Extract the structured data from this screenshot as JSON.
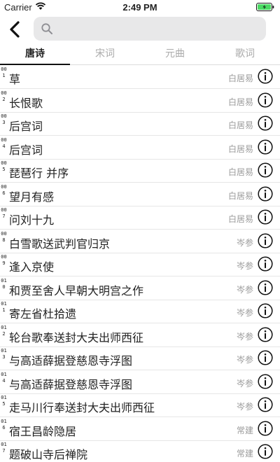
{
  "status": {
    "carrier": "Carrier",
    "time": "2:49 PM"
  },
  "search": {
    "value": "",
    "placeholder": ""
  },
  "tabs": [
    {
      "label": "唐诗",
      "active": true
    },
    {
      "label": "宋词",
      "active": false
    },
    {
      "label": "元曲",
      "active": false
    },
    {
      "label": "歌词",
      "active": false
    }
  ],
  "poems": [
    {
      "index": "001",
      "title": "草",
      "author": "白居易"
    },
    {
      "index": "002",
      "title": "长恨歌",
      "author": "白居易"
    },
    {
      "index": "003",
      "title": "后宫词",
      "author": "白居易"
    },
    {
      "index": "004",
      "title": "后宫词",
      "author": "白居易"
    },
    {
      "index": "005",
      "title": "琵琶行 并序",
      "author": "白居易"
    },
    {
      "index": "006",
      "title": "望月有感",
      "author": "白居易"
    },
    {
      "index": "007",
      "title": "问刘十九",
      "author": "白居易"
    },
    {
      "index": "008",
      "title": "白雪歌送武判官归京",
      "author": "岑参"
    },
    {
      "index": "009",
      "title": "逢入京使",
      "author": "岑参"
    },
    {
      "index": "010",
      "title": "和贾至舍人早朝大明宫之作",
      "author": "岑参"
    },
    {
      "index": "011",
      "title": "寄左省杜拾遗",
      "author": "岑参"
    },
    {
      "index": "012",
      "title": "轮台歌奉送封大夫出师西征",
      "author": "岑参"
    },
    {
      "index": "013",
      "title": "与高适薛据登慈恩寺浮图",
      "author": "岑参"
    },
    {
      "index": "014",
      "title": "与高适薛据登慈恩寺浮图",
      "author": "岑参"
    },
    {
      "index": "015",
      "title": "走马川行奉送封大夫出师西征",
      "author": "岑参"
    },
    {
      "index": "016",
      "title": "宿王昌龄隐居",
      "author": "常建"
    },
    {
      "index": "017",
      "title": "题破山寺后禅院",
      "author": "常建"
    }
  ],
  "colors": {
    "accent": "#111111",
    "muted": "#9a9a9a",
    "battery": "#4cd964"
  }
}
